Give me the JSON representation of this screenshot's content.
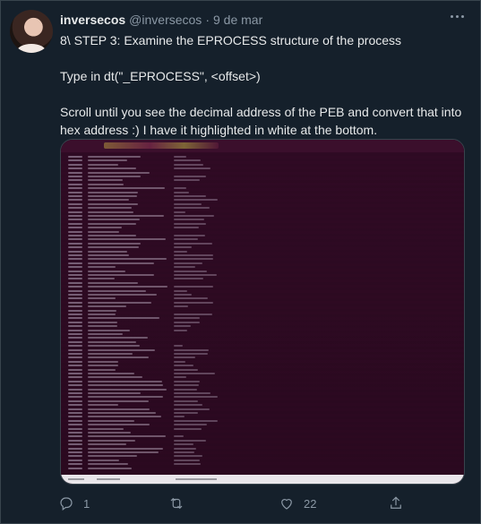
{
  "tweet": {
    "author_name": "inversecos",
    "author_handle": "@inversecos",
    "separator": "·",
    "date": "9 de mar",
    "paragraphs": [
      "8\\ STEP 3: Examine the EPROCESS structure of the process",
      "Type in dt(\"_EPROCESS\", <offset>)",
      "Scroll until you see the decimal address of the PEB and convert that into\nhex address :) I have it highlighted in white at the bottom."
    ]
  },
  "actions": {
    "reply_count": "1",
    "retweet_count": "",
    "like_count": "22"
  },
  "icons": {
    "more": "more-horizontal-icon",
    "reply": "reply-icon",
    "retweet": "retweet-icon",
    "like": "heart-icon",
    "share": "share-icon"
  },
  "colors": {
    "background": "#15202b",
    "terminal": "#300a24",
    "muted": "#8b98a5"
  }
}
